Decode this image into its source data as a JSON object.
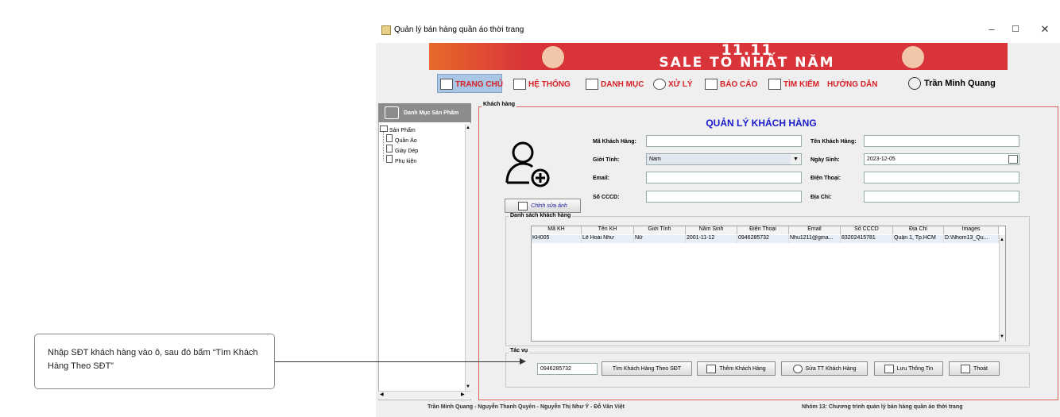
{
  "window": {
    "title": "Quản lý bán hàng quần áo thời trang",
    "controls": {
      "minimize": "–",
      "maximize": "☐",
      "close": "✕"
    }
  },
  "banner": {
    "line1": "11.11",
    "line2": "SALE TO NHẤT NĂM"
  },
  "menu": {
    "items": [
      "TRANG CHỦ",
      "HỆ THỐNG",
      "DANH MỤC",
      "XỬ LÝ",
      "BÁO CÁO",
      "TÌM KIẾM",
      "HƯỚNG DẪN"
    ],
    "user": "Trần Minh Quang"
  },
  "sidebar": {
    "header": "Danh Mục Sản Phẩm",
    "root": "Sản Phẩm",
    "children": [
      "Quần Áo",
      "Giày Dép",
      "Phụ kiện"
    ]
  },
  "form": {
    "panel_title": "Khách hàng",
    "heading": "QUẢN LÝ KHÁCH HÀNG",
    "labels": {
      "ma_kh": "Mã Khách Hàng:",
      "ten_kh": "Tên Khách Hàng:",
      "gioi_tinh": "Giới Tính:",
      "ngay_sinh": "Ngày Sinh:",
      "email": "Email:",
      "dien_thoai": "Điện Thoại:",
      "cccd": "Số CCCD:",
      "dia_chi": "Địa Chỉ:"
    },
    "values": {
      "ma_kh": "",
      "ten_kh": "",
      "gioi_tinh": "Nam",
      "ngay_sinh": "2023-12-05",
      "email": "",
      "dien_thoai": "",
      "cccd": "",
      "dia_chi": ""
    },
    "edit_image_button": "Chỉnh sửa ảnh"
  },
  "table": {
    "title": "Danh sách khách hàng",
    "columns": [
      "Mã KH",
      "Tên KH",
      "Giới Tính",
      "Năm Sinh",
      "Điện Thoại",
      "Email",
      "Số CCCD",
      "Địa Chỉ",
      "Images"
    ],
    "rows": [
      [
        "KH005",
        "Lê Hoài Như",
        "Nữ",
        "2001-11-12",
        "0946285732",
        "Nhu1211@gma...",
        "83202415781",
        "Quận 1, Tp.HCM",
        "D:\\Nhom13_Qu..."
      ]
    ]
  },
  "actions": {
    "title": "Tác vụ",
    "search_value": "0946285732",
    "buttons": [
      "Tìm Khách Hàng Theo SĐT",
      "Thêm Khách Hàng",
      "Sửa TT Khách Hàng",
      "Lưu Thông Tin",
      "Thoát"
    ]
  },
  "footer": {
    "authors": "Trần Minh Quang - Nguyễn Thanh Quyền - Nguyễn Thị Như Ý - Đỗ Văn Việt",
    "project": "Nhóm 13: Chương trình quản lý bán hàng quần áo thời trang"
  },
  "callout": {
    "text": "Nhập SĐT khách hàng vào ô, sau đó bấm “Tìm Khách Hàng Theo SĐT”"
  }
}
